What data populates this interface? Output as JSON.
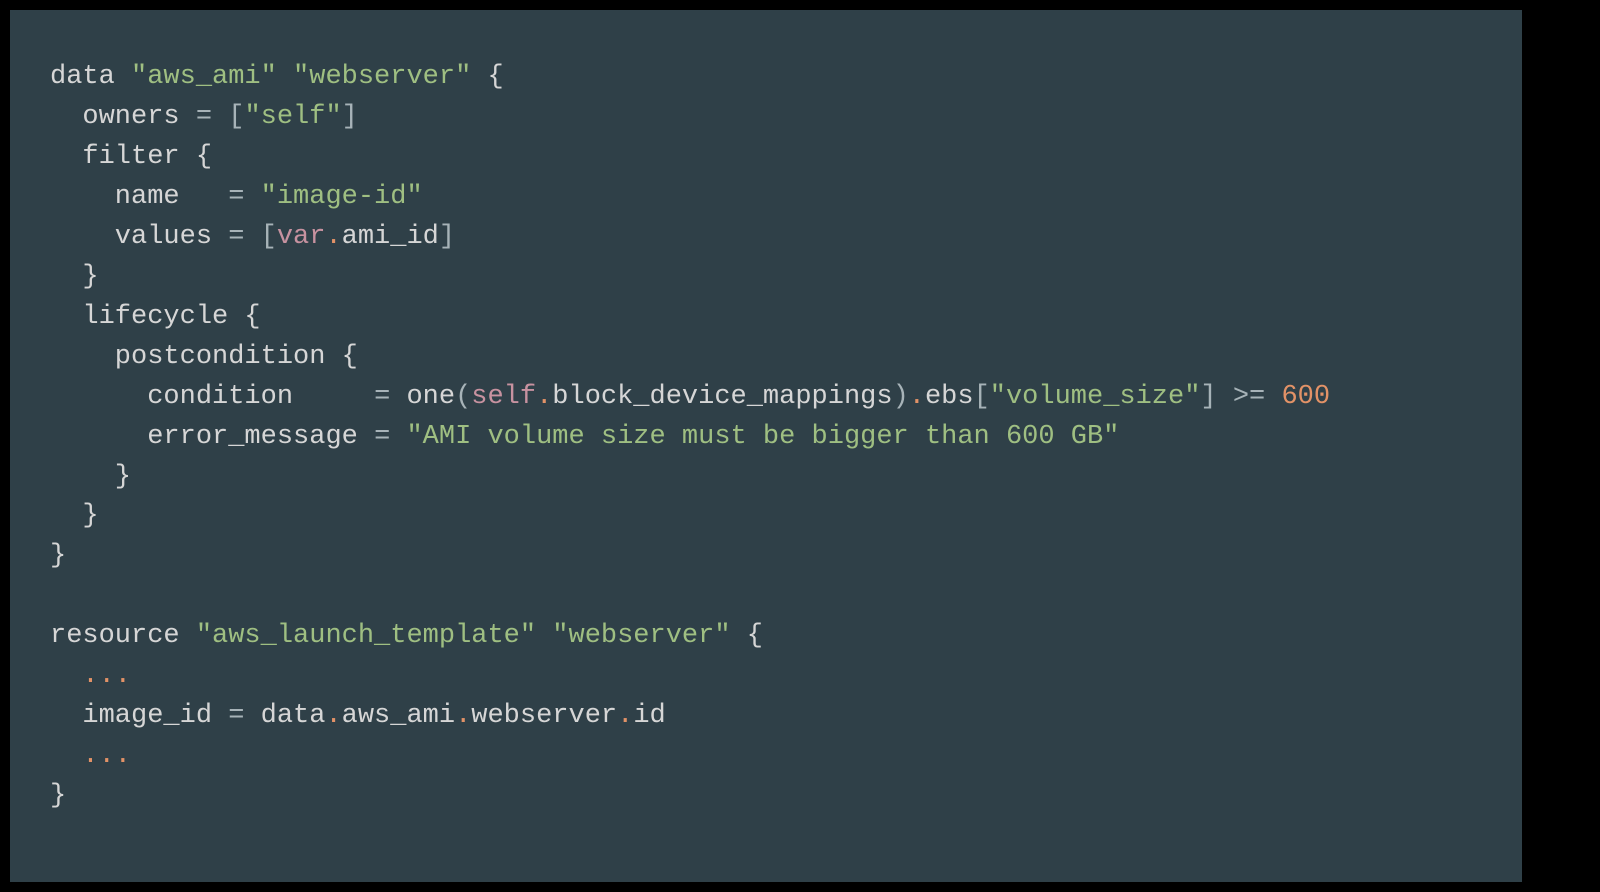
{
  "colors": {
    "bg_outer": "#000000",
    "bg_code": "#2f4048",
    "default": "#d6d6d6",
    "string": "#9fbf82",
    "keyword": "#c792a0",
    "number": "#e29267",
    "punct": "#a7b3b8",
    "punct_orange": "#e29267"
  },
  "code_lines": [
    [
      {
        "t": "data ",
        "c": "default"
      },
      {
        "t": "\"aws_ami\"",
        "c": "string"
      },
      {
        "t": " ",
        "c": "default"
      },
      {
        "t": "\"webserver\"",
        "c": "string"
      },
      {
        "t": " {",
        "c": "default"
      }
    ],
    [
      {
        "t": "  owners ",
        "c": "default"
      },
      {
        "t": "=",
        "c": "punct"
      },
      {
        "t": " ",
        "c": "default"
      },
      {
        "t": "[",
        "c": "punct"
      },
      {
        "t": "\"self\"",
        "c": "string"
      },
      {
        "t": "]",
        "c": "punct"
      }
    ],
    [
      {
        "t": "  filter {",
        "c": "default"
      }
    ],
    [
      {
        "t": "    name   ",
        "c": "default"
      },
      {
        "t": "=",
        "c": "punct"
      },
      {
        "t": " ",
        "c": "default"
      },
      {
        "t": "\"image-id\"",
        "c": "string"
      }
    ],
    [
      {
        "t": "    values ",
        "c": "default"
      },
      {
        "t": "=",
        "c": "punct"
      },
      {
        "t": " ",
        "c": "default"
      },
      {
        "t": "[",
        "c": "punct"
      },
      {
        "t": "var",
        "c": "keyword"
      },
      {
        "t": ".",
        "c": "punct-orange"
      },
      {
        "t": "ami_id",
        "c": "default"
      },
      {
        "t": "]",
        "c": "punct"
      }
    ],
    [
      {
        "t": "  }",
        "c": "default"
      }
    ],
    [
      {
        "t": "  lifecycle {",
        "c": "default"
      }
    ],
    [
      {
        "t": "    postcondition {",
        "c": "default"
      }
    ],
    [
      {
        "t": "      condition     ",
        "c": "default"
      },
      {
        "t": "=",
        "c": "punct"
      },
      {
        "t": " one",
        "c": "default"
      },
      {
        "t": "(",
        "c": "punct"
      },
      {
        "t": "self",
        "c": "keyword"
      },
      {
        "t": ".",
        "c": "punct-orange"
      },
      {
        "t": "block_device_mappings",
        "c": "default"
      },
      {
        "t": ")",
        "c": "punct"
      },
      {
        "t": ".",
        "c": "punct-orange"
      },
      {
        "t": "ebs",
        "c": "default"
      },
      {
        "t": "[",
        "c": "punct"
      },
      {
        "t": "\"volume_size\"",
        "c": "string"
      },
      {
        "t": "]",
        "c": "punct"
      },
      {
        "t": " ",
        "c": "default"
      },
      {
        "t": ">=",
        "c": "punct"
      },
      {
        "t": " ",
        "c": "default"
      },
      {
        "t": "600",
        "c": "number"
      }
    ],
    [
      {
        "t": "      error_message ",
        "c": "default"
      },
      {
        "t": "=",
        "c": "punct"
      },
      {
        "t": " ",
        "c": "default"
      },
      {
        "t": "\"AMI volume size must be bigger than 600 GB\"",
        "c": "string"
      }
    ],
    [
      {
        "t": "    }",
        "c": "default"
      }
    ],
    [
      {
        "t": "  }",
        "c": "default"
      }
    ],
    [
      {
        "t": "}",
        "c": "default"
      }
    ],
    [
      {
        "t": "",
        "c": "default"
      }
    ],
    [
      {
        "t": "resource ",
        "c": "default"
      },
      {
        "t": "\"aws_launch_template\"",
        "c": "string"
      },
      {
        "t": " ",
        "c": "default"
      },
      {
        "t": "\"webserver\"",
        "c": "string"
      },
      {
        "t": " {",
        "c": "default"
      }
    ],
    [
      {
        "t": "  ",
        "c": "default"
      },
      {
        "t": "...",
        "c": "punct-orange"
      }
    ],
    [
      {
        "t": "  image_id ",
        "c": "default"
      },
      {
        "t": "=",
        "c": "punct"
      },
      {
        "t": " data",
        "c": "default"
      },
      {
        "t": ".",
        "c": "punct-orange"
      },
      {
        "t": "aws_ami",
        "c": "default"
      },
      {
        "t": ".",
        "c": "punct-orange"
      },
      {
        "t": "webserver",
        "c": "default"
      },
      {
        "t": ".",
        "c": "punct-orange"
      },
      {
        "t": "id",
        "c": "default"
      }
    ],
    [
      {
        "t": "  ",
        "c": "default"
      },
      {
        "t": "...",
        "c": "punct-orange"
      }
    ],
    [
      {
        "t": "}",
        "c": "default"
      }
    ]
  ]
}
